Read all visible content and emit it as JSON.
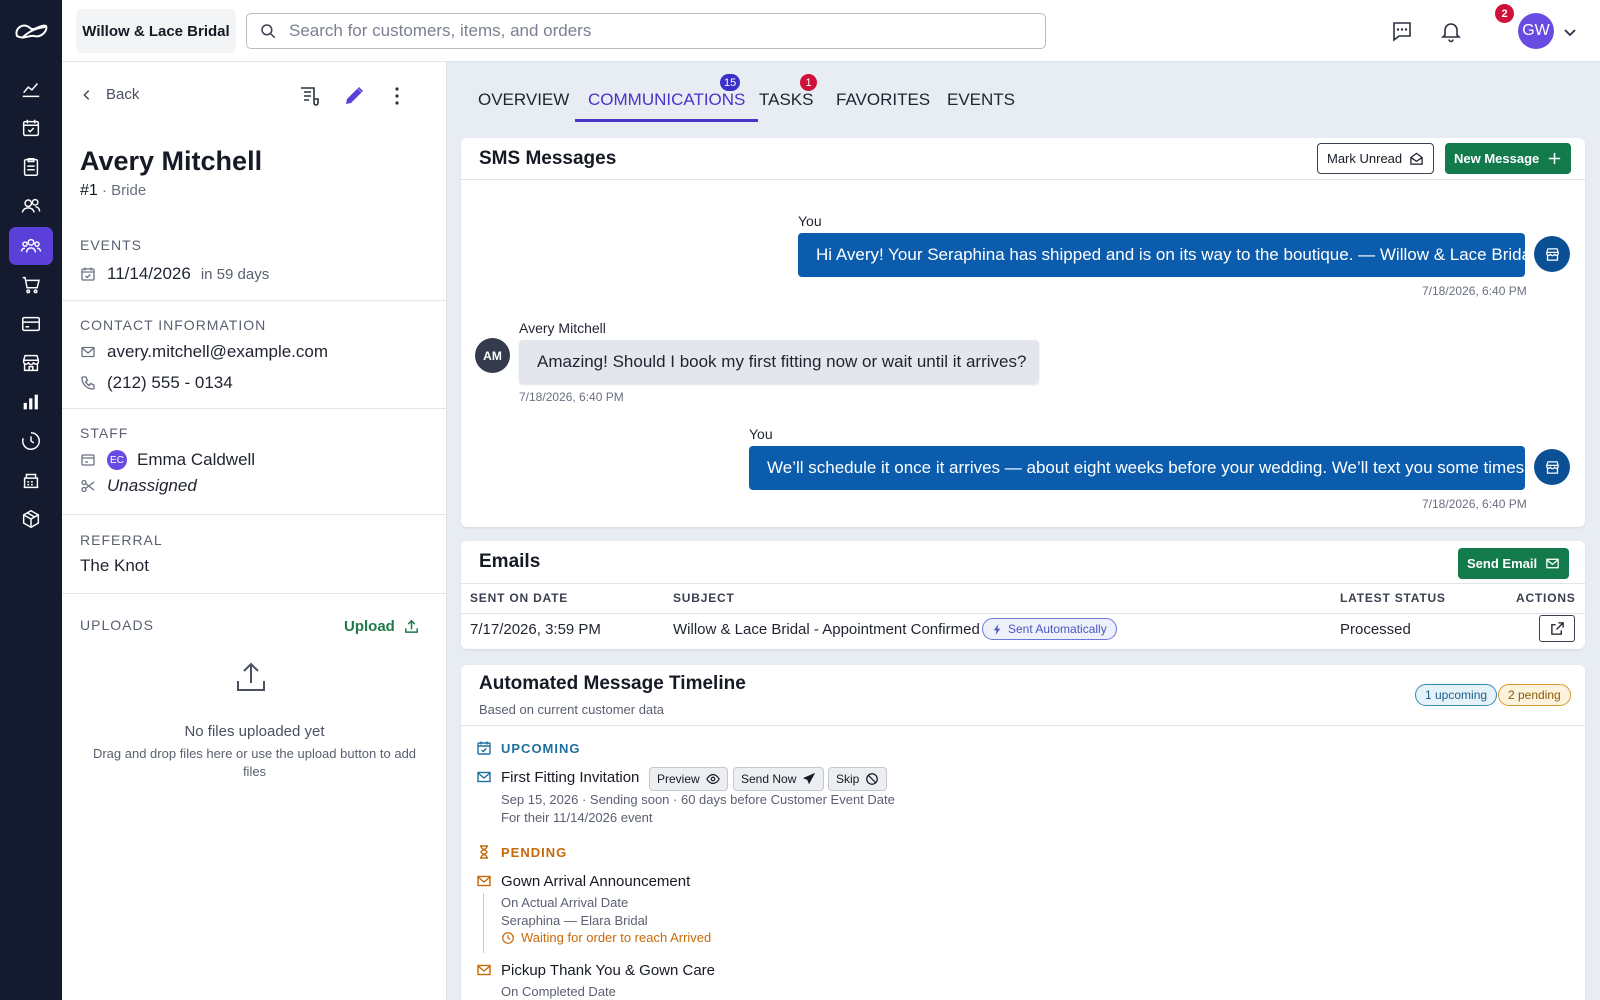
{
  "app": {
    "store_name": "Willow & Lace Bridal",
    "search_placeholder": "Search for customers, items, and orders",
    "notification_count": "2",
    "user_initials": "GW"
  },
  "nav": {
    "items": [
      "dashboard-icon",
      "calendar-check-icon",
      "clipboard-icon",
      "contacts-icon",
      "customers-icon",
      "cart-icon",
      "card-icon",
      "store-icon",
      "bar-chart-icon",
      "clock-pie-icon",
      "register-icon",
      "package-icon"
    ],
    "active_index": 4
  },
  "customer": {
    "back_label": "Back",
    "name": "Avery Mitchell",
    "number": "#1",
    "role": "Bride",
    "events_label": "EVENTS",
    "event_date": "11/14/2026",
    "event_relative": "in 59 days",
    "contact_label": "CONTACT INFORMATION",
    "email": "avery.mitchell@example.com",
    "phone": "(212) 555 - 0134",
    "staff_label": "STAFF",
    "staff_initials": "EC",
    "staff_name": "Emma Caldwell",
    "staff_secondary": "Unassigned",
    "referral_label": "REFERRAL",
    "referral": "The Knot",
    "uploads_label": "UPLOADS",
    "upload_button": "Upload",
    "empty_title": "No files uploaded yet",
    "empty_sub": "Drag and drop files here or use the upload button to add files"
  },
  "tabs": [
    {
      "label": "OVERVIEW",
      "badge": ""
    },
    {
      "label": "COMMUNICATIONS",
      "badge": "15",
      "active": true
    },
    {
      "label": "TASKS",
      "badge": "1"
    },
    {
      "label": "FAVORITES",
      "badge": ""
    },
    {
      "label": "EVENTS",
      "badge": ""
    }
  ],
  "sms": {
    "title": "SMS Messages",
    "mark_unread": "Mark Unread",
    "new_message": "New Message",
    "messages": [
      {
        "author": "You",
        "text": "Hi Avery! Your Seraphina has shipped and is on its way to the boutique. — Willow & Lace Bridal",
        "time": "7/18/2026, 6:40 PM",
        "direction": "out"
      },
      {
        "author": "Avery Mitchell",
        "initials": "AM",
        "text": "Amazing! Should I book my first fitting now or wait until it arrives?",
        "time": "7/18/2026, 6:40 PM",
        "direction": "in"
      },
      {
        "author": "You",
        "text": "We’ll schedule it once it arrives — about eight weeks before your wedding. We’ll text you some times!",
        "time": "7/18/2026, 6:40 PM",
        "direction": "out"
      }
    ]
  },
  "emails": {
    "title": "Emails",
    "send_email": "Send Email",
    "columns": [
      "SENT ON DATE",
      "SUBJECT",
      "LATEST STATUS",
      "ACTIONS"
    ],
    "rows": [
      {
        "sent": "7/17/2026, 3:59 PM",
        "subject": "Willow & Lace Bridal - Appointment Confirmed",
        "tag": "Sent Automatically",
        "status": "Processed"
      }
    ]
  },
  "timeline": {
    "title": "Automated Message Timeline",
    "subtitle": "Based on current customer data",
    "upcoming_count": "1 upcoming",
    "pending_count": "2 pending",
    "upcoming_label": "UPCOMING",
    "pending_label": "PENDING",
    "upcoming": [
      {
        "title": "First Fitting Invitation",
        "detail1": "Sep 15, 2026 · Sending soon · 60 days before Customer Event Date",
        "detail2": "For their 11/14/2026 event",
        "preview": "Preview",
        "send_now": "Send Now",
        "skip": "Skip"
      }
    ],
    "pending": [
      {
        "title": "Gown Arrival Announcement",
        "detail1": "On Actual Arrival Date",
        "detail2": "Seraphina — Elara Bridal",
        "waiting": "Waiting for order to reach Arrived"
      },
      {
        "title": "Pickup Thank You & Gown Care",
        "detail1": "On Completed Date"
      }
    ]
  },
  "colors": {
    "rail": "#141b2e",
    "accent": "#4a33c9",
    "sms_out": "#0b5cad",
    "green": "#137a4b",
    "badge_red": "#d0103a",
    "pending_orange": "#c86a08"
  }
}
